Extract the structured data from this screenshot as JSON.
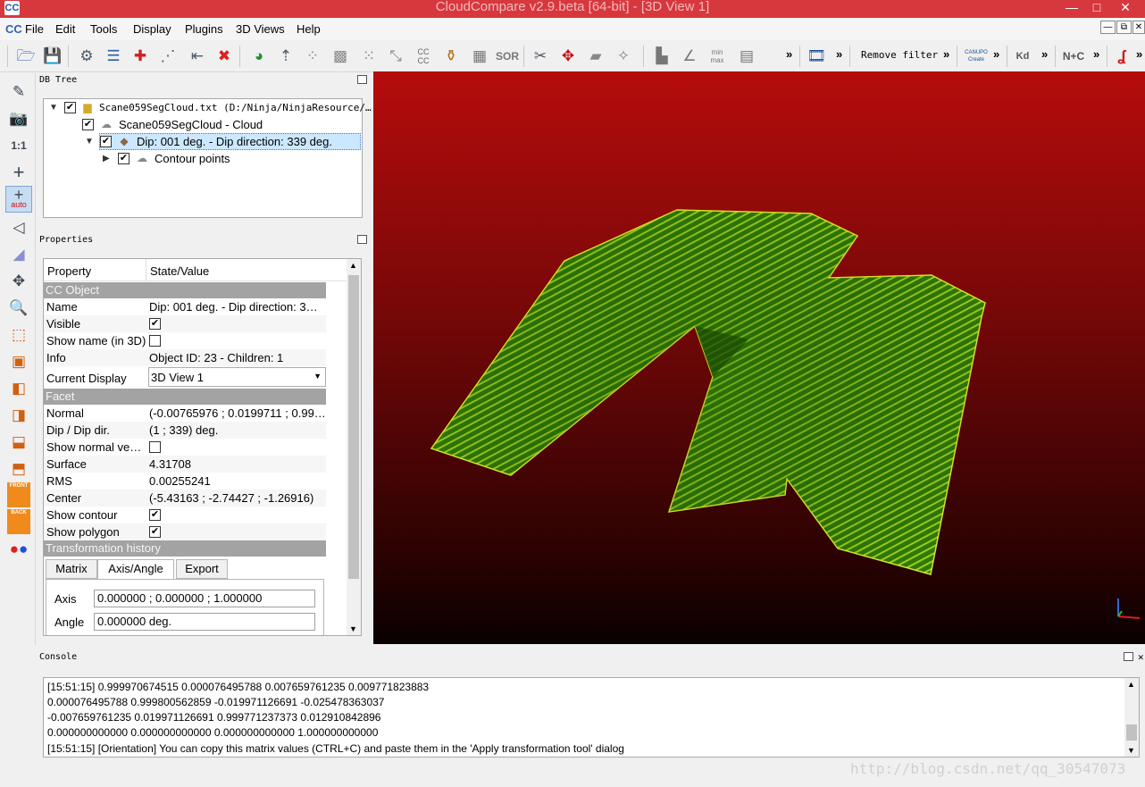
{
  "window": {
    "title": "CloudCompare v2.9.beta [64-bit] - [3D View 1]",
    "app_icon": "CC",
    "controls": [
      "—",
      "□",
      "✕"
    ]
  },
  "menubar": {
    "logo": "CC",
    "items": [
      "File",
      "Edit",
      "Tools",
      "Display",
      "Plugins",
      "3D Views",
      "Help"
    ],
    "mdi_controls": [
      "—",
      "⧉",
      "✕"
    ]
  },
  "toolbar": {
    "remove_filter_label": "Remove filter",
    "more_glyph": "»",
    "icons": [
      "open-icon",
      "save-icon",
      "settings-icon",
      "list-icon",
      "merge-icon",
      "segment-icon",
      "crop-icon",
      "delete-icon",
      "color-icon",
      "normals-icon",
      "sample-icon",
      "filter-icon",
      "noise-icon",
      "scale-icon",
      "cc-icon",
      "bucket-icon",
      "checker-icon",
      "sor-icon",
      "scissors-icon",
      "translate-icon",
      "plane-icon",
      "pick-icon",
      "histogram-icon",
      "stats-icon",
      "minmax-icon",
      "trash-icon",
      "film-icon",
      "canupo-icon",
      "kd-icon",
      "nc-icon",
      "s-icon"
    ],
    "icon_text": {
      "cc": "CC\nCC",
      "sor": "SOR",
      "kd": "Kd",
      "nc": "N+C",
      "canupo": "CANUPO\nCreate",
      "minmax": "min\nmax"
    }
  },
  "left_toolbar": {
    "icons": [
      "pencil-icon",
      "camera-icon",
      "one-to-one-icon",
      "crosshair-icon",
      "auto-pivot-icon",
      "perspective-icon",
      "light-icon",
      "move-icon",
      "zoom-icon",
      "view-top-icon",
      "view-front-icon",
      "view-left-icon",
      "view-right-icon",
      "view-bottom-icon",
      "view-iso-icon",
      "front-icon",
      "back-icon",
      "stereo-icon"
    ],
    "labels": {
      "one_to_one": "1:1",
      "auto": "auto",
      "front": "FRONT",
      "back": "BACK"
    }
  },
  "db_tree": {
    "title": "DB Tree",
    "items": [
      {
        "label": "Scane059SegCloud.txt (D:/Ninja/NinjaResource/…",
        "checked": true,
        "icon": "folder-icon",
        "expanded": true
      },
      {
        "label": "Scane059SegCloud - Cloud",
        "checked": true,
        "icon": "cloud-icon"
      },
      {
        "label": "Dip: 001 deg. - Dip direction: 339 deg.",
        "checked": true,
        "icon": "facet-icon",
        "expanded": true,
        "selected": true
      },
      {
        "label": "Contour points",
        "checked": true,
        "icon": "cloud-icon",
        "expanded": false
      }
    ]
  },
  "properties": {
    "title": "Properties",
    "header": {
      "property": "Property",
      "value": "State/Value"
    },
    "sections": {
      "cc_object": "CC Object",
      "facet": "Facet",
      "transformation": "Transformation history"
    },
    "cc_object_rows": [
      {
        "key": "Name",
        "value": "Dip: 001 deg. - Dip direction: 3…"
      },
      {
        "key": "Visible",
        "value": "✔"
      },
      {
        "key": "Show name (in 3D)",
        "value": ""
      },
      {
        "key": "Info",
        "value": "Object ID: 23 - Children: 1"
      },
      {
        "key": "Current Display",
        "value": "3D View 1"
      }
    ],
    "facet_rows": [
      {
        "key": "Normal",
        "value": "(-0.00765976 ; 0.0199711 ; 0.99…"
      },
      {
        "key": "Dip / Dip dir.",
        "value": "(1 ; 339) deg."
      },
      {
        "key": "Show normal ve…",
        "value": ""
      },
      {
        "key": "Surface",
        "value": "4.31708"
      },
      {
        "key": "RMS",
        "value": "0.00255241"
      },
      {
        "key": "Center",
        "value": "(-5.43163 ; -2.74427 ; -1.26916)"
      },
      {
        "key": "Show contour",
        "value": "✔"
      },
      {
        "key": "Show polygon",
        "value": "✔"
      }
    ],
    "tabs": [
      "Matrix",
      "Axis/Angle",
      "Export"
    ],
    "active_tab": "Axis/Angle",
    "axis_label": "Axis",
    "axis_value": "0.000000 ; 0.000000 ; 1.000000",
    "angle_label": "Angle",
    "angle_value": "0.000000 deg."
  },
  "console": {
    "title": "Console",
    "lines": [
      "[15:51:15] 0.999970674515 0.000076495788 0.007659761235 0.009771823883",
      "0.000076495788 0.999800562859 -0.019971126691 -0.025478363037",
      "-0.007659761235 0.019971126691 0.999771237373 0.012910842896",
      "0.000000000000 0.000000000000 0.000000000000 1.000000000000",
      "[15:51:15] [Orientation] You can copy this matrix values (CTRL+C) and paste them in the 'Apply transformation tool' dialog"
    ]
  },
  "watermark": "http://blog.csdn.net/qq_30547073",
  "colors": {
    "titlebar": "#d6383e",
    "view_top": "#b60c0c",
    "facet_green": "#2f7a06",
    "contour_yellow": "#d8e62a",
    "section_gray": "#a3a3a3",
    "selection": "#cce8ff"
  }
}
